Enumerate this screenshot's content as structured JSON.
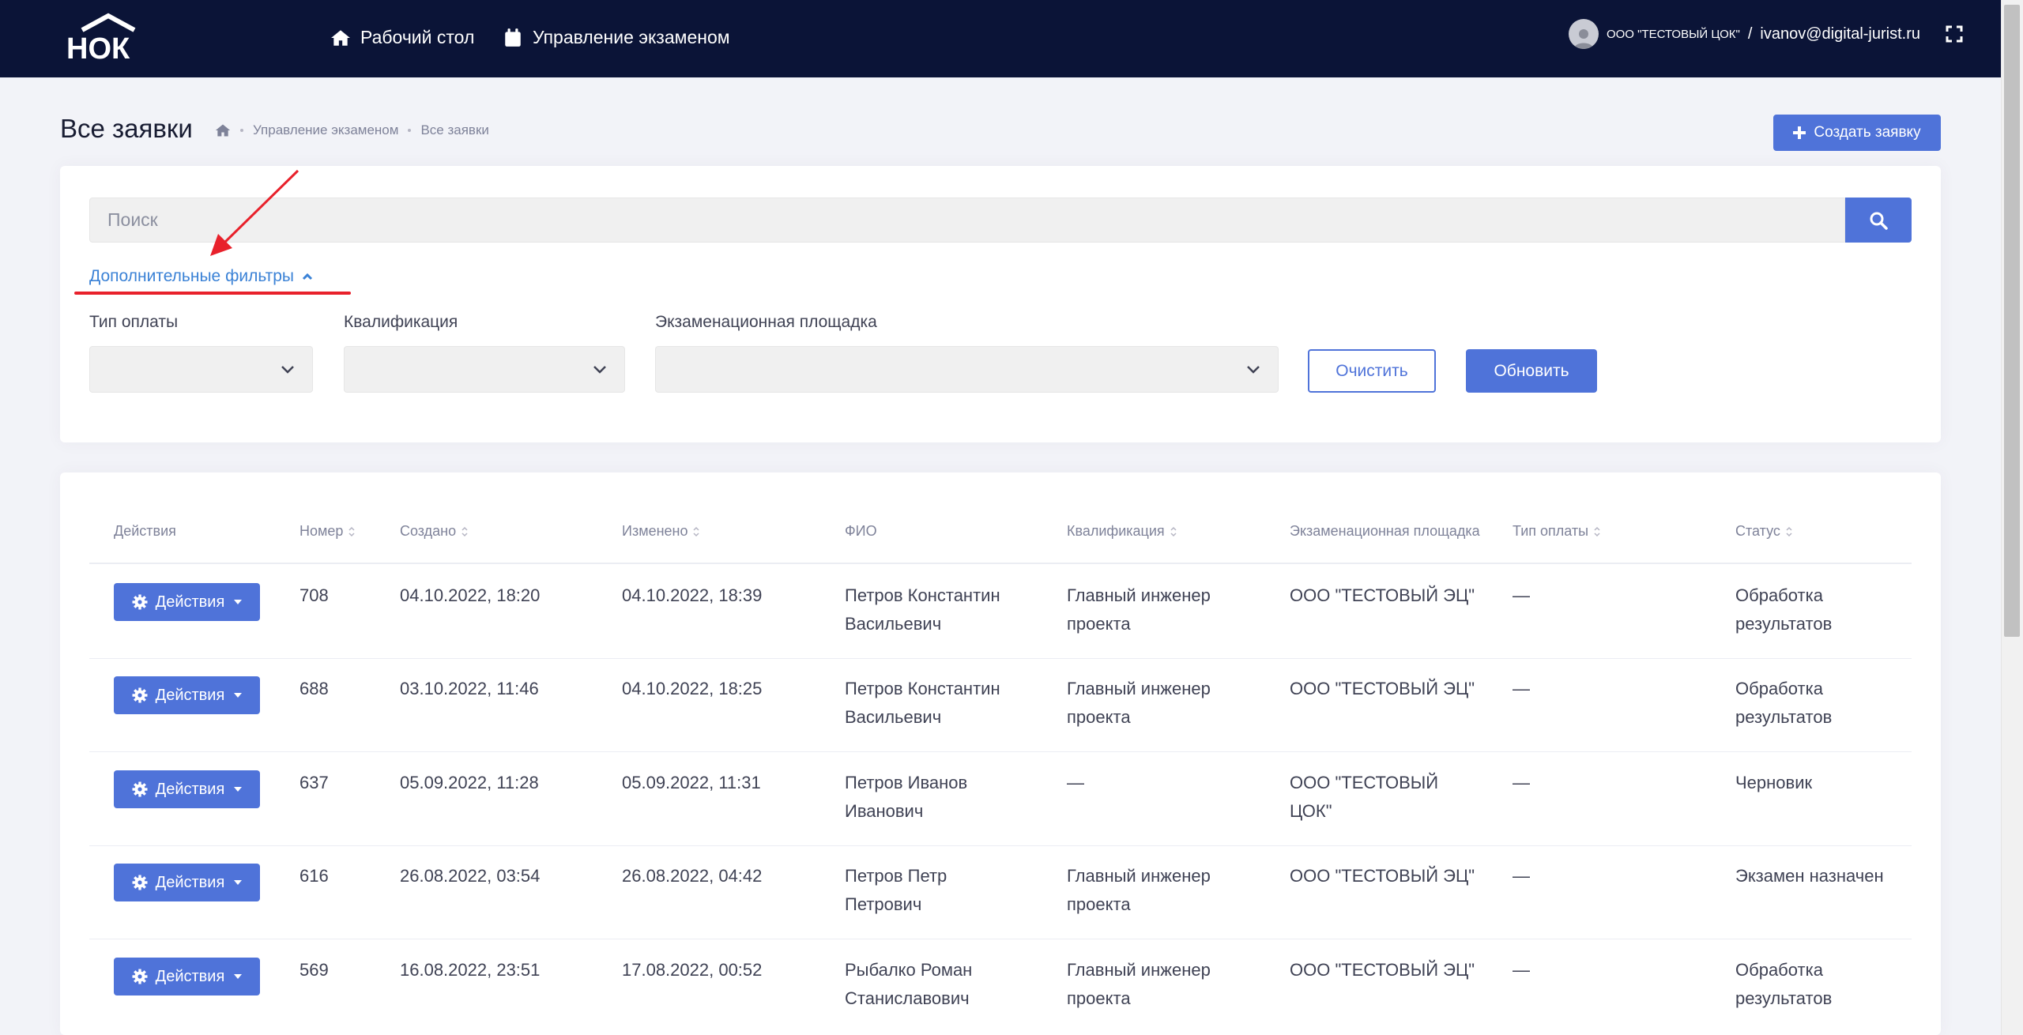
{
  "navbar": {
    "logo_text": "НОК",
    "items": [
      {
        "label": "Рабочий стол",
        "icon": "home-icon"
      },
      {
        "label": "Управление экзаменом",
        "icon": "calendar-icon"
      }
    ],
    "user_org": "ООО \"ТЕСТОВЫЙ ЦОК\"",
    "user_sep": "/",
    "user_email": "ivanov@digital-jurist.ru",
    "fullscreen_icon": "fullscreen-icon"
  },
  "subheader": {
    "title": "Все заявки",
    "breadcrumb": [
      "Управление экзаменом",
      "Все заявки"
    ],
    "create_button": "Создать заявку"
  },
  "filters": {
    "search_placeholder": "Поиск",
    "toggle_label": "Дополнительные фильтры",
    "labels": [
      "Тип оплаты",
      "Квалификация",
      "Экзаменационная площадка"
    ],
    "clear_button": "Очистить",
    "refresh_button": "Обновить"
  },
  "table": {
    "columns": [
      "Действия",
      "Номер",
      "Создано",
      "Изменено",
      "ФИО",
      "Квалификация",
      "Экзаменационная площадка",
      "Тип оплаты",
      "Статус"
    ],
    "action_label": "Действия",
    "rows": [
      {
        "number": "708",
        "created": "04.10.2022, 18:20",
        "changed": "04.10.2022, 18:39",
        "fio1": "Петров Константин",
        "fio2": "Васильевич",
        "qual1": "Главный инженер",
        "qual2": "проекта",
        "place1": "ООО \"ТЕСТОВЫЙ ЭЦ\"",
        "place2": "",
        "payment": "—",
        "status1": "Обработка",
        "status2": "результатов"
      },
      {
        "number": "688",
        "created": "03.10.2022, 11:46",
        "changed": "04.10.2022, 18:25",
        "fio1": "Петров Константин",
        "fio2": "Васильевич",
        "qual1": "Главный инженер",
        "qual2": "проекта",
        "place1": "ООО \"ТЕСТОВЫЙ ЭЦ\"",
        "place2": "",
        "payment": "—",
        "status1": "Обработка",
        "status2": "результатов"
      },
      {
        "number": "637",
        "created": "05.09.2022, 11:28",
        "changed": "05.09.2022, 11:31",
        "fio1": "Петров Иванов",
        "fio2": "Иванович",
        "qual1": "—",
        "qual2": "",
        "place1": "ООО \"ТЕСТОВЫЙ",
        "place2": "ЦОК\"",
        "payment": "—",
        "status1": "Черновик",
        "status2": ""
      },
      {
        "number": "616",
        "created": "26.08.2022, 03:54",
        "changed": "26.08.2022, 04:42",
        "fio1": "Петров Петр",
        "fio2": "Петрович",
        "qual1": "Главный инженер",
        "qual2": "проекта",
        "place1": "ООО \"ТЕСТОВЫЙ ЭЦ\"",
        "place2": "",
        "payment": "—",
        "status1": "Экзамен назначен",
        "status2": ""
      },
      {
        "number": "569",
        "created": "16.08.2022, 23:51",
        "changed": "17.08.2022, 00:52",
        "fio1": "Рыбалко Роман",
        "fio2": "Станиславович",
        "qual1": "Главный инженер",
        "qual2": "проекта",
        "place1": "ООО \"ТЕСТОВЫЙ ЭЦ\"",
        "place2": "",
        "payment": "—",
        "status1": "Обработка",
        "status2": "результатов"
      }
    ]
  },
  "colors": {
    "navbar": "#0b1437",
    "primary": "#4f73d9",
    "link": "#3b82d6",
    "annotation": "#e8212b"
  }
}
